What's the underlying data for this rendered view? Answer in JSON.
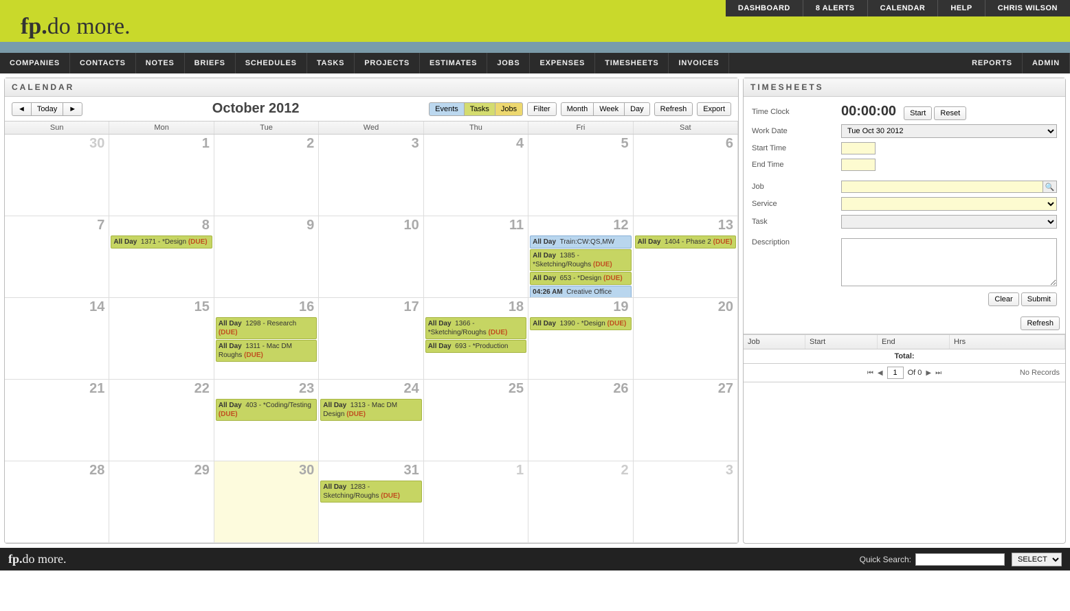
{
  "brand": {
    "bold": "fp.",
    "text": "do more."
  },
  "topnav": [
    "DASHBOARD",
    "8 ALERTS",
    "CALENDAR",
    "HELP",
    "CHRIS WILSON"
  ],
  "mainnav_left": [
    "COMPANIES",
    "CONTACTS",
    "NOTES",
    "BRIEFS",
    "SCHEDULES",
    "TASKS",
    "PROJECTS",
    "ESTIMATES",
    "JOBS",
    "EXPENSES",
    "TIMESHEETS",
    "INVOICES"
  ],
  "mainnav_right": [
    "REPORTS",
    "ADMIN"
  ],
  "calendar": {
    "title": "CALENDAR",
    "month_label": "October 2012",
    "today_label": "Today",
    "prev_label": "◄",
    "next_label": "►",
    "toggles": {
      "events": "Events",
      "tasks": "Tasks",
      "jobs": "Jobs"
    },
    "filter_label": "Filter",
    "ranges": {
      "month": "Month",
      "week": "Week",
      "day": "Day"
    },
    "refresh_label": "Refresh",
    "export_label": "Export",
    "weekdays": [
      "Sun",
      "Mon",
      "Tue",
      "Wed",
      "Thu",
      "Fri",
      "Sat"
    ],
    "cells": [
      {
        "n": "30",
        "other": true
      },
      {
        "n": "1"
      },
      {
        "n": "2"
      },
      {
        "n": "3"
      },
      {
        "n": "4"
      },
      {
        "n": "5"
      },
      {
        "n": "6"
      },
      {
        "n": "7"
      },
      {
        "n": "8",
        "events": [
          {
            "type": "task",
            "time": "All Day",
            "text": "1371 - *Design",
            "due": true
          }
        ]
      },
      {
        "n": "9"
      },
      {
        "n": "10"
      },
      {
        "n": "11"
      },
      {
        "n": "12",
        "events": [
          {
            "type": "event",
            "time": "All Day",
            "text": "Train:CW:QS,MW"
          },
          {
            "type": "task",
            "time": "All Day",
            "text": "1385 - *Sketching/Roughs",
            "due": true
          },
          {
            "type": "task",
            "time": "All Day",
            "text": "653 - *Design",
            "due": true
          },
          {
            "type": "event",
            "time": "04:26 AM",
            "text": "Creative Office"
          }
        ]
      },
      {
        "n": "13",
        "events": [
          {
            "type": "task",
            "time": "All Day",
            "text": "1404 - Phase 2",
            "due": true
          }
        ]
      },
      {
        "n": "14"
      },
      {
        "n": "15"
      },
      {
        "n": "16",
        "events": [
          {
            "type": "task",
            "time": "All Day",
            "text": "1298 - Research",
            "due": true
          },
          {
            "type": "task",
            "time": "All Day",
            "text": "1311 - Mac DM Roughs",
            "due": true
          }
        ]
      },
      {
        "n": "17"
      },
      {
        "n": "18",
        "events": [
          {
            "type": "task",
            "time": "All Day",
            "text": "1366 - *Sketching/Roughs",
            "due": true
          },
          {
            "type": "task",
            "time": "All Day",
            "text": "693 - *Production"
          }
        ]
      },
      {
        "n": "19",
        "events": [
          {
            "type": "task",
            "time": "All Day",
            "text": "1390 - *Design",
            "due": true
          }
        ]
      },
      {
        "n": "20"
      },
      {
        "n": "21"
      },
      {
        "n": "22"
      },
      {
        "n": "23",
        "events": [
          {
            "type": "task",
            "time": "All Day",
            "text": "403 - *Coding/Testing",
            "due": true
          }
        ]
      },
      {
        "n": "24",
        "events": [
          {
            "type": "task",
            "time": "All Day",
            "text": "1313 - Mac DM Design",
            "due": true
          }
        ]
      },
      {
        "n": "25"
      },
      {
        "n": "26"
      },
      {
        "n": "27"
      },
      {
        "n": "28"
      },
      {
        "n": "29"
      },
      {
        "n": "30",
        "today": true
      },
      {
        "n": "31",
        "events": [
          {
            "type": "task",
            "time": "All Day",
            "text": "1283 - Sketching/Roughs",
            "due": true
          }
        ]
      },
      {
        "n": "1",
        "other": true
      },
      {
        "n": "2",
        "other": true
      },
      {
        "n": "3",
        "other": true
      }
    ],
    "due_label": "(DUE)"
  },
  "timesheets": {
    "title": "TIMESHEETS",
    "labels": {
      "time_clock": "Time Clock",
      "work_date": "Work Date",
      "start_time": "Start Time",
      "end_time": "End Time",
      "job": "Job",
      "service": "Service",
      "task": "Task",
      "description": "Description"
    },
    "clock": "00:00:00",
    "start_btn": "Start",
    "reset_btn": "Reset",
    "work_date_value": "Tue Oct 30 2012",
    "clear_btn": "Clear",
    "submit_btn": "Submit",
    "refresh_btn": "Refresh",
    "table_headers": {
      "job": "Job",
      "start": "Start",
      "end": "End",
      "hrs": "Hrs"
    },
    "total_label": "Total:",
    "pager": {
      "page": "1",
      "of": "Of 0",
      "no_records": "No Records"
    }
  },
  "footer": {
    "quick_search_label": "Quick Search:",
    "select_label": "SELECT"
  }
}
